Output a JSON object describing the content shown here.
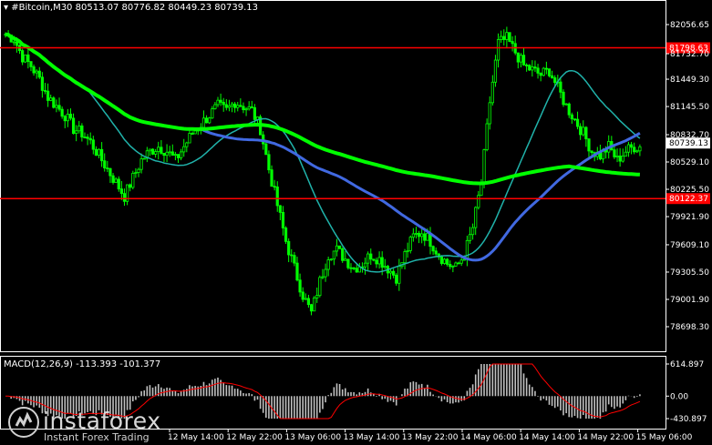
{
  "header": {
    "symbol": "#Bitcoin,M30",
    "ohlc": "80513.07 80776.82 80449.23 80739.13"
  },
  "price_axis": {
    "labels": [
      "82056.65",
      "81732.70",
      "81449.30",
      "81145.50",
      "80832.70",
      "80529.10",
      "80225.50",
      "79921.90",
      "79609.10",
      "79305.50",
      "79001.90",
      "78698.30"
    ],
    "values": [
      82056.65,
      81732.7,
      81449.3,
      81145.5,
      80832.7,
      80529.1,
      80225.5,
      79921.9,
      79609.1,
      79305.5,
      79001.9,
      78698.3
    ]
  },
  "levels": {
    "upper": {
      "label": "81798.63",
      "value": 81798.63,
      "color": "#ff0000"
    },
    "lower": {
      "label": "80122.37",
      "value": 80122.37,
      "color": "#ff0000"
    },
    "current": {
      "label": "80739.13",
      "value": 80739.13
    }
  },
  "time_axis": {
    "labels": [
      "12 May 14:00",
      "12 May 22:00",
      "13 May 06:00",
      "13 May 14:00",
      "13 May 22:00",
      "14 May 06:00",
      "14 May 14:00",
      "14 May 22:00",
      "15 May 06:00"
    ]
  },
  "macd": {
    "title": "MACD(12,26,9) -113.393 -101.377",
    "axis_labels": [
      "614.897",
      "0.00",
      "-430.897"
    ],
    "axis_values": [
      614.897,
      0.0,
      -430.897
    ]
  },
  "logo": {
    "name": "instaforex",
    "tagline": "Instant Forex Trading"
  },
  "colors": {
    "background": "#000000",
    "candles": "#00ff00",
    "ma_thick": "#00ff00",
    "ma_blue": "#4169e1",
    "ma_teal": "#20b2aa",
    "level_line": "#ff0000",
    "macd_hist": "#c0c0c0",
    "macd_signal": "#ff0000"
  },
  "chart_data": {
    "type": "candlestick",
    "series": [
      {
        "name": "price",
        "values": [
          81950,
          81900,
          81700,
          81600,
          81450,
          81250,
          81150,
          81050,
          80900,
          80850,
          80750,
          80600,
          80450,
          80300,
          80150,
          80350,
          80550,
          80650,
          80700,
          80650,
          80550,
          80700,
          80850,
          80950,
          81050,
          81150,
          81100,
          81200,
          81150,
          81100,
          80900,
          80450,
          80050,
          79650,
          79350,
          79050,
          78850,
          79200,
          79500,
          79550,
          79450,
          79350,
          79400,
          79500,
          79450,
          79350,
          79250,
          79500,
          79700,
          79750,
          79650,
          79500,
          79400,
          79350,
          79500,
          79800,
          80300,
          81200,
          81850,
          81900,
          81750,
          81600,
          81550,
          81500,
          81550,
          81350,
          81150,
          81000,
          80850,
          80650,
          80600,
          80700,
          80550,
          80650,
          80700
        ]
      }
    ]
  }
}
